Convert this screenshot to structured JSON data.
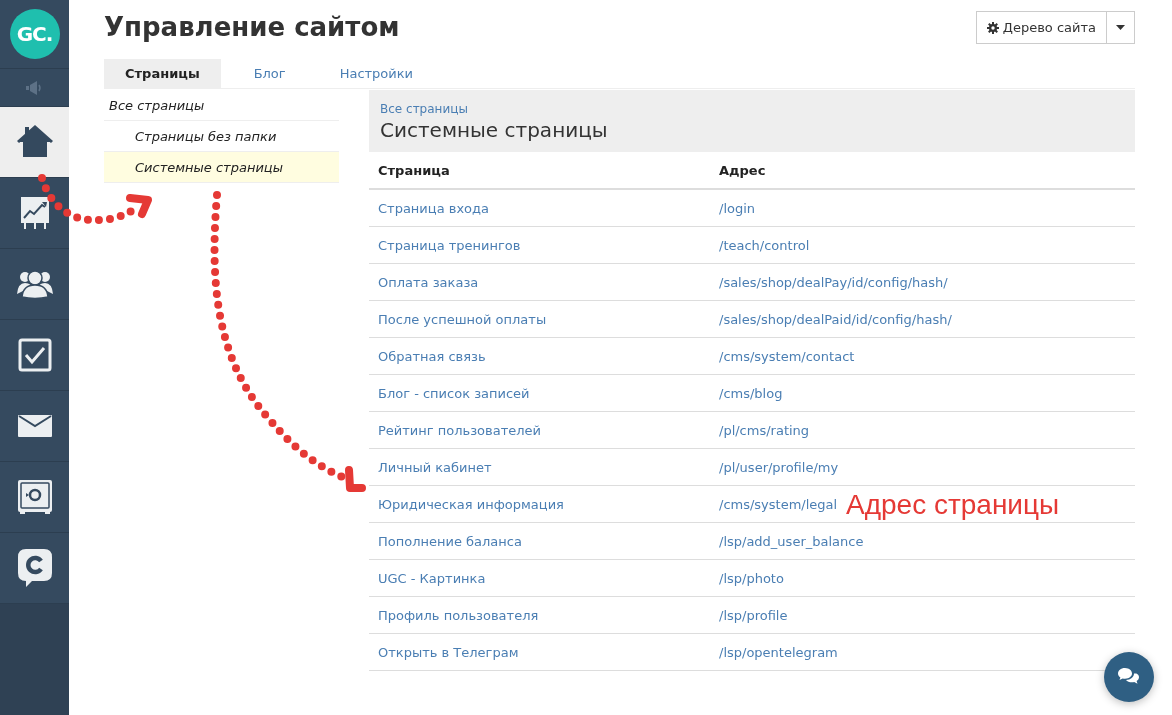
{
  "logo": {
    "text": "GC."
  },
  "sidebar": {
    "items": [
      {
        "selected": false
      },
      {
        "selected": true
      },
      {
        "selected": false
      },
      {
        "selected": false
      },
      {
        "selected": false
      },
      {
        "selected": false
      },
      {
        "selected": false
      },
      {
        "selected": false
      }
    ]
  },
  "title": "Управление сайтом",
  "site_tree_button": {
    "label": "Дерево сайта"
  },
  "tabs": [
    {
      "label": "Страницы",
      "selected": true
    },
    {
      "label": "Блог",
      "selected": false
    },
    {
      "label": "Настройки",
      "selected": false
    }
  ],
  "tree": [
    {
      "label": "Все страницы",
      "selected": false,
      "children": [
        {
          "label": "Страницы без папки",
          "selected": false
        },
        {
          "label": "Системные страницы",
          "selected": true
        }
      ]
    }
  ],
  "panel": {
    "breadcrumb": "Все страницы",
    "heading": "Системные страницы"
  },
  "table": {
    "columns": [
      "Страница",
      "Адрес"
    ],
    "rows": [
      [
        "Страница входа",
        "/login"
      ],
      [
        "Страница тренингов",
        "/teach/control"
      ],
      [
        "Оплата заказа",
        "/sales/shop/dealPay/id/config/hash/"
      ],
      [
        "После успешной оплаты",
        "/sales/shop/dealPaid/id/config/hash/"
      ],
      [
        "Обратная связь",
        "/cms/system/contact"
      ],
      [
        "Блог - список записей",
        "/cms/blog"
      ],
      [
        "Рейтинг пользователей",
        "/pl/cms/rating"
      ],
      [
        "Личный кабинет",
        "/pl/user/profile/my"
      ],
      [
        "Юридическая информация",
        "/cms/system/legal"
      ],
      [
        "Пополнение баланса",
        "/lsp/add_user_balance"
      ],
      [
        "UGC - Картинка",
        "/lsp/photo"
      ],
      [
        "Профиль пользователя",
        "/lsp/profile"
      ],
      [
        "Открыть в Телеграм",
        "/lsp/opentelegram"
      ]
    ]
  },
  "annotation": {
    "text": "Адрес страницы"
  }
}
